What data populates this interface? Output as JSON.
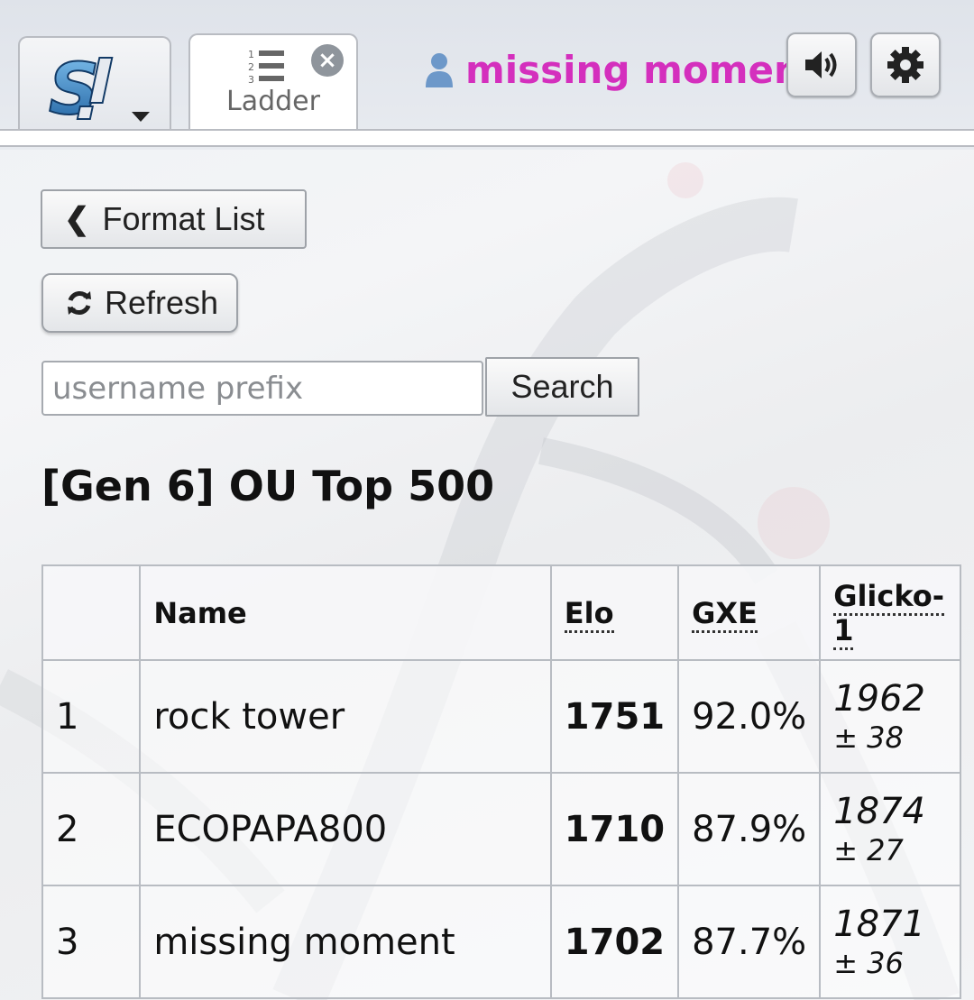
{
  "header": {
    "ladder_tab_label": "Ladder",
    "username": "missing moment",
    "icons": {
      "logo": "showdown-logo",
      "menu_caret": "chevron-down-icon",
      "ladder": "ordered-list-icon",
      "close": "close-icon",
      "user": "user-icon",
      "sound": "volume-icon",
      "settings": "gear-icon"
    },
    "username_color": "#d42fbd"
  },
  "controls": {
    "format_list_label": "Format List",
    "refresh_label": "Refresh",
    "search_placeholder": "username prefix",
    "search_value": "",
    "search_button_label": "Search"
  },
  "ladder": {
    "title": "[Gen 6] OU Top 500",
    "columns": {
      "rank": "",
      "name": "Name",
      "elo": "Elo",
      "gxe": "GXE",
      "glicko": "Glicko-1"
    },
    "rows": [
      {
        "rank": "1",
        "name": "rock tower",
        "elo": "1751",
        "gxe": "92.0%",
        "glicko": "1962",
        "glicko_dev": "± 38"
      },
      {
        "rank": "2",
        "name": "ECOPAPA800",
        "elo": "1710",
        "gxe": "87.9%",
        "glicko": "1874",
        "glicko_dev": "± 27"
      },
      {
        "rank": "3",
        "name": "missing moment",
        "elo": "1702",
        "gxe": "87.7%",
        "glicko": "1871",
        "glicko_dev": "± 36"
      }
    ]
  }
}
